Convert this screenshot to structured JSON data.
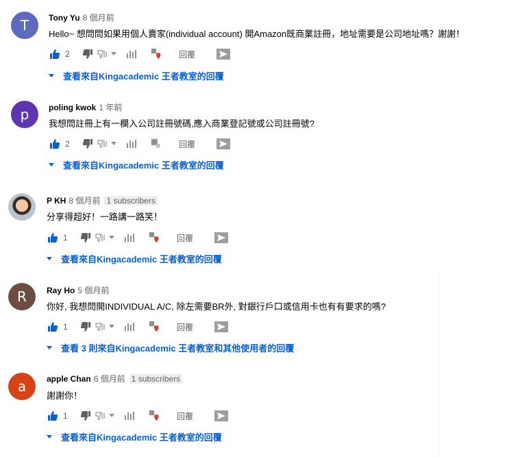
{
  "comments": [
    {
      "author": "Tony Yu",
      "time": "8 個月前",
      "badge": "",
      "text": "Hello~ 想問問如果用個人賣家(individual account) 開Amazon既商業註冊，地址需要是公司地址嗎？謝謝！",
      "likes": "2",
      "reply_label": "回覆",
      "replies_label": "查看來自Kingacademic 王者教室的回覆",
      "avatar_letter": "T",
      "avatar_color": "#5c6bc0"
    },
    {
      "author": "poling kwok",
      "time": "1 年前",
      "badge": "",
      "text": "我想問註冊上有一欄入公司註冊號碼,應入商業登記號或公司註冊號?",
      "likes": "2",
      "reply_label": "回覆",
      "replies_label": "查看來自Kingacademic 王者教室的回覆",
      "avatar_letter": "p",
      "avatar_color": "#5e35b1"
    },
    {
      "author": "P KH",
      "time": "8 個月前",
      "badge": "1 subscribers",
      "text": "分享得超好！一路講一路笑！",
      "likes": "1",
      "reply_label": "回覆",
      "replies_label": "查看來自Kingacademic 王者教室的回覆",
      "avatar_letter": "",
      "avatar_color": "#b9c4cf"
    },
    {
      "author": "Ray Ho",
      "time": "5 個月前",
      "badge": "",
      "text": "你好, 我想問開INDIVIDUAL A/C, 除左需要BR外, 對銀行戶口或信用卡也有有要求的嗎?",
      "likes": "1",
      "reply_label": "回覆",
      "replies_label": "查看 3 則來自Kingacademic 王者教室和其他使用者的回覆",
      "avatar_letter": "R",
      "avatar_color": "#6d4c41"
    },
    {
      "author": "apple Chan",
      "time": "6 個月前",
      "badge": "1 subscribers",
      "text": "謝謝你！",
      "likes": "1",
      "reply_label": "回覆",
      "replies_label": "查看來自Kingacademic 王者教室的回覆",
      "avatar_letter": "a",
      "avatar_color": "#d84315"
    }
  ],
  "colors": {
    "link": "#065fd4",
    "like_icon": "#065fd4",
    "heart": "#e53935",
    "icon_gray": "#909090"
  }
}
